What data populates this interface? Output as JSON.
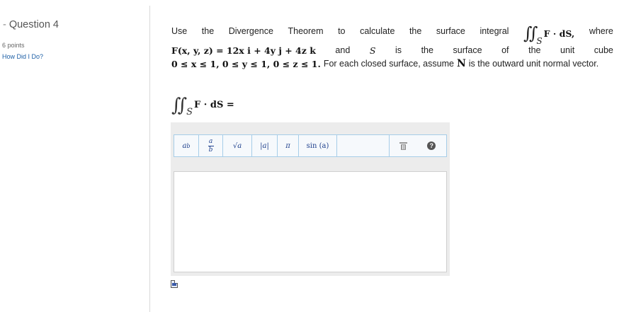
{
  "sidebar": {
    "question_title": "Question 4",
    "dash": "-",
    "points": "6 points",
    "how_did_i_do": "How Did I Do?"
  },
  "problem": {
    "line1_words": [
      "Use",
      "the",
      "Divergence",
      "Theorem",
      "to",
      "calculate",
      "the",
      "surface",
      "integral"
    ],
    "integral_symbol": "∬",
    "integral_sub": "S",
    "integrand": "F · dS,",
    "where": "where",
    "field_expr": "F(x, y, z) = 12x i + 4y j + 4z k",
    "line2_words": [
      "and",
      "S",
      "is",
      "the",
      "surface",
      "of",
      "the",
      "unit",
      "cube"
    ],
    "bounds": "0 ≤ x ≤ 1, 0 ≤ y ≤ 1, 0 ≤ z ≤ 1.",
    "sentence_tail_pre": "For each closed surface, assume",
    "normal_symbol": "N",
    "sentence_tail_post": "is the outward unit normal vector."
  },
  "equation": {
    "integral_symbol": "∬",
    "integral_sub": "S",
    "integrand": "F · dS ="
  },
  "toolbar": {
    "buttons": [
      {
        "name": "superscript-button",
        "label": "a",
        "sup": "b"
      },
      {
        "name": "fraction-button",
        "num": "a",
        "den": "b"
      },
      {
        "name": "sqrt-button",
        "label": "√a"
      },
      {
        "name": "abs-button",
        "label": "|a|"
      },
      {
        "name": "pi-button",
        "label": "π"
      },
      {
        "name": "sin-button",
        "label": "sin (a)"
      }
    ],
    "help_label": "?"
  },
  "answer": {
    "value": ""
  },
  "colors": {
    "link": "#1d5fa6",
    "toolbar_border": "#a6cde8",
    "toolbar_text": "#1d3f8c"
  }
}
